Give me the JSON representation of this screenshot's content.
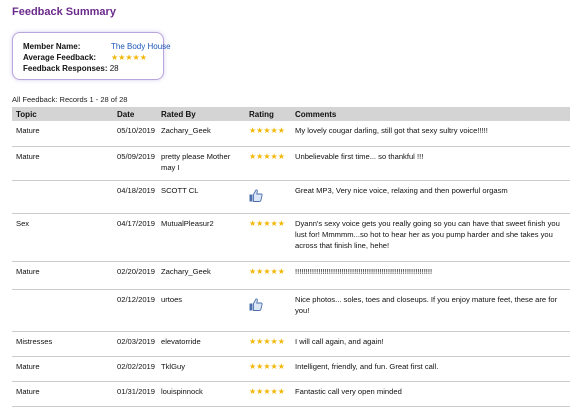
{
  "page": {
    "title": "Feedback Summary"
  },
  "summary": {
    "member_name_label": "Member Name:",
    "member_name": "The Body House",
    "average_feedback_label": "Average Feedback:",
    "average_feedback_stars": "★★★★★",
    "feedback_responses_label": "Feedback Responses:",
    "feedback_responses": "28"
  },
  "records_line": "All Feedback:  Records 1 - 28 of 28",
  "table": {
    "headers": {
      "topic": "Topic",
      "date": "Date",
      "rated_by": "Rated By",
      "rating": "Rating",
      "comments": "Comments"
    },
    "rows": [
      {
        "topic": "Mature",
        "date": "05/10/2019",
        "rated_by": "Zachary_Geek",
        "rating_type": "stars",
        "rating": "★★★★★",
        "comments": "My lovely cougar darling, still got that sexy sultry voice!!!!!"
      },
      {
        "topic": "Mature",
        "date": "05/09/2019",
        "rated_by": "pretty please Mother may I",
        "rating_type": "stars",
        "rating": "★★★★★",
        "comments": "Unbelievable first time... so thankful !!!"
      },
      {
        "topic": "",
        "date": "04/18/2019",
        "rated_by": "SCOTT CL",
        "rating_type": "thumb",
        "rating_icon": "thumbs-up-icon",
        "comments": "Great MP3, Very nice voice, relaxing and then powerful orgasm"
      },
      {
        "topic": "Sex",
        "date": "04/17/2019",
        "rated_by": "MutualPleasur2",
        "rating_type": "stars",
        "rating": "★★★★★",
        "comments": "Dyann's sexy voice gets you really going so you can have that sweet finish you lust for! Mmmmm...so hot to hear her as you pump harder and she takes you across that finish line, hehe!"
      },
      {
        "topic": "Mature",
        "date": "02/20/2019",
        "rated_by": "Zachary_Geek",
        "rating_type": "stars",
        "rating": "★★★★★",
        "comments": "!!!!!!!!!!!!!!!!!!!!!!!!!!!!!!!!!!!!!!!!!!!!!!!!!!!!!!!!!!!!!!!!!"
      },
      {
        "topic": "",
        "date": "02/12/2019",
        "rated_by": "urtoes",
        "rating_type": "thumb",
        "rating_icon": "thumbs-up-icon",
        "comments": "Nice photos... soles, toes and closeups. If you enjoy mature feet, these are for you!"
      },
      {
        "topic": "Mistresses",
        "date": "02/03/2019",
        "rated_by": "elevatorride",
        "rating_type": "stars",
        "rating": "★★★★★",
        "comments": "I will call again, and again!"
      },
      {
        "topic": "Mature",
        "date": "02/02/2019",
        "rated_by": "TklGuy",
        "rating_type": "stars",
        "rating": "★★★★★",
        "comments": "Intelligent, friendly, and fun. Great first call."
      },
      {
        "topic": "Mature",
        "date": "01/31/2019",
        "rated_by": "louispinnock",
        "rating_type": "stars",
        "rating": "★★★★★",
        "comments": "Fantastic call very open minded"
      }
    ]
  },
  "colors": {
    "title": "#6a2a8c",
    "link": "#1a56b8",
    "star": "#f2b705",
    "header_bg": "#d4d4d4",
    "box_border": "#b9a6dd",
    "thumb": "#4d6fae"
  }
}
